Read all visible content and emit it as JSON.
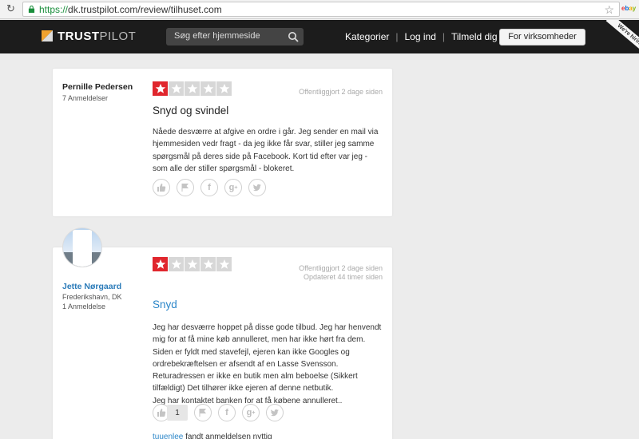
{
  "browser": {
    "url_scheme": "https://",
    "url_rest": "dk.trustpilot.com/review/tilhuset.com",
    "extension": [
      "e",
      "b",
      "a",
      "y"
    ]
  },
  "header": {
    "logo_bold": "TRUST",
    "logo_thin": "PILOT",
    "search_placeholder": "Søg efter hjemmeside",
    "nav": [
      "Kategorier",
      "Log ind",
      "Tilmeld dig"
    ],
    "business_button": "For virksomheder",
    "ribbon": "We're hiring",
    "colors": {
      "header_bg": "#1c1c1c",
      "accent": "#f0a22e",
      "star_on": "#e0262d"
    }
  },
  "reviews": [
    {
      "reviewer_name": "Pernille Pedersen",
      "reviewer_count": "7 Anmeldelser",
      "rating": 1,
      "published": "Offentliggjort 2 dage siden",
      "title": "Snyd og svindel",
      "body": [
        "Nåede desværre at afgive en ordre i går. Jeg sender en mail via",
        "hjemmesiden vedr fragt - da jeg ikke får svar, stiller jeg samme",
        "spørgsmål på deres side på Facebook. Kort tid efter var jeg -",
        "som alle der stiller spørgsmål - blokeret."
      ],
      "actions": [
        "thumbs-up-icon",
        "flag-icon",
        "facebook-icon",
        "google-plus-icon",
        "twitter-icon"
      ]
    },
    {
      "reviewer_name": "Jette Nørgaard",
      "reviewer_location": "Frederikshavn, DK",
      "reviewer_count": "1 Anmeldelse",
      "rating": 1,
      "published": "Offentliggjort 2 dage siden",
      "updated": "Opdateret 44 timer siden",
      "title": "Snyd",
      "body": [
        "Jeg har desværre hoppet på disse gode tilbud. Jeg har henvendt",
        "mig for at få mine køb annulleret, men har ikke hørt fra dem.",
        "Siden er fyldt med stavefejl, ejeren kan ikke Googles og",
        "ordrebekræftelsen er afsendt af en Lasse Svensson.",
        "Returadressen er ikke en butik men alm beboelse (Sikkert",
        "tilfældigt) Det tilhører ikke ejeren af denne netbutik.",
        "Jeg har kontaktet banken for at få købene annulleret.."
      ],
      "useful_count": "1",
      "found_useful_user": "tuuenlee",
      "found_useful_text": " fandt anmeldelsen nyttig"
    }
  ]
}
